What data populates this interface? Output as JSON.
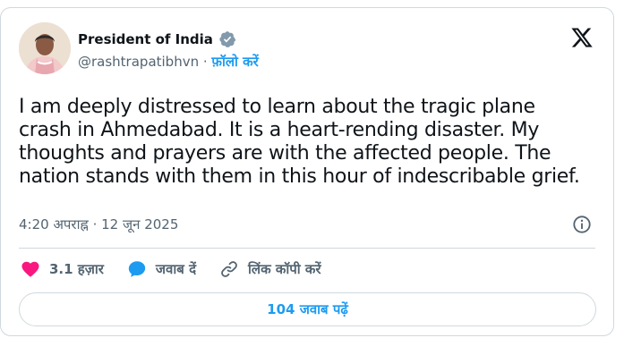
{
  "author": {
    "name": "President of India",
    "handle": "@rashtrapatibhvn",
    "separator": " · ",
    "follow_label": "फ़ॉलो करें",
    "verified_icon": "verified-badge-icon",
    "avatar_icon": "profile-photo"
  },
  "platform_icon": "x-logo-icon",
  "tweet": {
    "text": "I am deeply distressed to learn about the tragic plane\ncrash in Ahmedabad. It is a heart-rending disaster. My\nthoughts and prayers are with the affected people. The\nnation stands with them in this hour of indescribable grief.",
    "time": "4:20 अपराह्न",
    "date_separator": " · ",
    "date": "12 जून 2025"
  },
  "actions": {
    "like_count": "3.1 हज़ार",
    "reply_label": "जवाब दें",
    "copy_link_label": "लिंक कॉपी करें"
  },
  "read_replies_label": "104 जवाब पढ़ें",
  "colors": {
    "accent": "#1d9bf0",
    "like": "#f91880",
    "text": "#0f1419",
    "muted": "#536471",
    "border": "#cfd9de",
    "verified": "#829aab"
  }
}
